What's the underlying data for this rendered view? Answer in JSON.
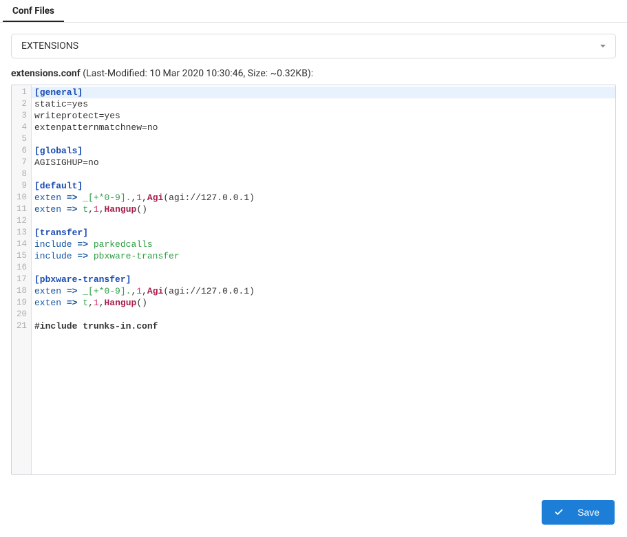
{
  "tabs": {
    "active_label": "Conf Files"
  },
  "selector": {
    "value": "EXTENSIONS"
  },
  "file": {
    "name": "extensions.conf",
    "meta_suffix": " (Last-Modified: 10 Mar 2020 10:30:46, Size: ~0.32KB):"
  },
  "editor": {
    "lines": [
      [
        {
          "t": "[general]",
          "c": "tok-section"
        }
      ],
      [
        {
          "t": "static=yes",
          "c": "tok-plain"
        }
      ],
      [
        {
          "t": "writeprotect=yes",
          "c": "tok-plain"
        }
      ],
      [
        {
          "t": "extenpatternmatchnew=no",
          "c": "tok-plain"
        }
      ],
      [],
      [
        {
          "t": "[globals]",
          "c": "tok-section"
        }
      ],
      [
        {
          "t": "AGISIGHUP=no",
          "c": "tok-plain"
        }
      ],
      [],
      [
        {
          "t": "[default]",
          "c": "tok-section"
        }
      ],
      [
        {
          "t": "exten",
          "c": "tok-key"
        },
        {
          "t": " ",
          "c": "tok-plain"
        },
        {
          "t": "=>",
          "c": "tok-op"
        },
        {
          "t": " ",
          "c": "tok-plain"
        },
        {
          "t": "_[+*0-9].",
          "c": "tok-green"
        },
        {
          "t": ",",
          "c": "tok-plain"
        },
        {
          "t": "1",
          "c": "tok-num"
        },
        {
          "t": ",",
          "c": "tok-plain"
        },
        {
          "t": "Agi",
          "c": "tok-call"
        },
        {
          "t": "(agi://127.0.0.1)",
          "c": "tok-plain"
        }
      ],
      [
        {
          "t": "exten",
          "c": "tok-key"
        },
        {
          "t": " ",
          "c": "tok-plain"
        },
        {
          "t": "=>",
          "c": "tok-op"
        },
        {
          "t": " ",
          "c": "tok-plain"
        },
        {
          "t": "t",
          "c": "tok-green"
        },
        {
          "t": ",",
          "c": "tok-plain"
        },
        {
          "t": "1",
          "c": "tok-num"
        },
        {
          "t": ",",
          "c": "tok-plain"
        },
        {
          "t": "Hangup",
          "c": "tok-call"
        },
        {
          "t": "()",
          "c": "tok-plain"
        }
      ],
      [],
      [
        {
          "t": "[transfer]",
          "c": "tok-section"
        }
      ],
      [
        {
          "t": "include",
          "c": "tok-key"
        },
        {
          "t": " ",
          "c": "tok-plain"
        },
        {
          "t": "=>",
          "c": "tok-op"
        },
        {
          "t": " ",
          "c": "tok-plain"
        },
        {
          "t": "parkedcalls",
          "c": "tok-green"
        }
      ],
      [
        {
          "t": "include",
          "c": "tok-key"
        },
        {
          "t": " ",
          "c": "tok-plain"
        },
        {
          "t": "=>",
          "c": "tok-op"
        },
        {
          "t": " ",
          "c": "tok-plain"
        },
        {
          "t": "pbxware-transfer",
          "c": "tok-green"
        }
      ],
      [],
      [
        {
          "t": "[pbxware-transfer]",
          "c": "tok-section"
        }
      ],
      [
        {
          "t": "exten",
          "c": "tok-key"
        },
        {
          "t": " ",
          "c": "tok-plain"
        },
        {
          "t": "=>",
          "c": "tok-op"
        },
        {
          "t": " ",
          "c": "tok-plain"
        },
        {
          "t": "_[+*0-9].",
          "c": "tok-green"
        },
        {
          "t": ",",
          "c": "tok-plain"
        },
        {
          "t": "1",
          "c": "tok-num"
        },
        {
          "t": ",",
          "c": "tok-plain"
        },
        {
          "t": "Agi",
          "c": "tok-call"
        },
        {
          "t": "(agi://127.0.0.1)",
          "c": "tok-plain"
        }
      ],
      [
        {
          "t": "exten",
          "c": "tok-key"
        },
        {
          "t": " ",
          "c": "tok-plain"
        },
        {
          "t": "=>",
          "c": "tok-op"
        },
        {
          "t": " ",
          "c": "tok-plain"
        },
        {
          "t": "t",
          "c": "tok-green"
        },
        {
          "t": ",",
          "c": "tok-plain"
        },
        {
          "t": "1",
          "c": "tok-num"
        },
        {
          "t": ",",
          "c": "tok-plain"
        },
        {
          "t": "Hangup",
          "c": "tok-call"
        },
        {
          "t": "()",
          "c": "tok-plain"
        }
      ],
      [],
      [
        {
          "t": "#include trunks-in.conf",
          "c": "tok-strong"
        }
      ]
    ]
  },
  "buttons": {
    "save": "Save"
  }
}
